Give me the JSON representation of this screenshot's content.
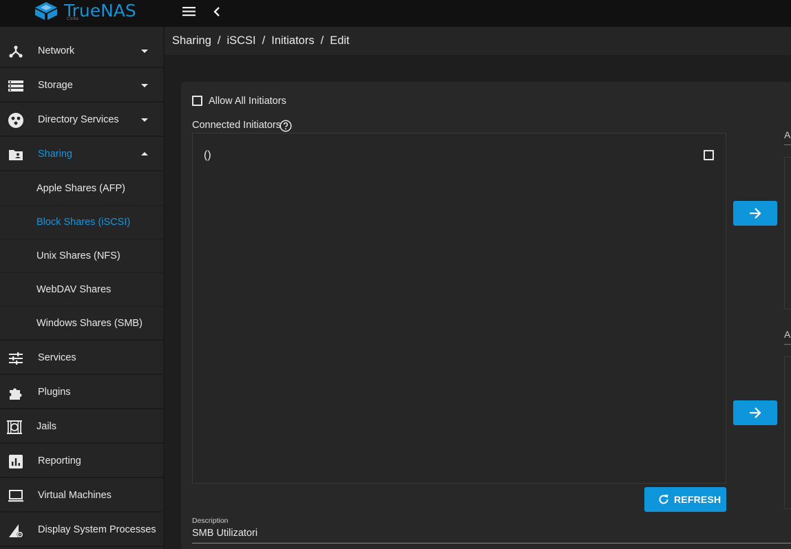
{
  "app": {
    "logo_text": "TrueNAS",
    "logo_subtext": "CORE",
    "accent_color": "#0f95d9"
  },
  "topbar": {
    "menu_icon": "hamburger-menu-icon",
    "back_icon": "chevron-left-icon"
  },
  "sidebar": {
    "items": [
      {
        "label": "Network",
        "icon": "network-icon",
        "expanded": false
      },
      {
        "label": "Storage",
        "icon": "storage-icon",
        "expanded": false
      },
      {
        "label": "Directory Services",
        "icon": "directory-services-icon",
        "expanded": false
      },
      {
        "label": "Sharing",
        "icon": "sharing-folder-icon",
        "expanded": true,
        "active": true
      },
      {
        "label": "Services",
        "icon": "tune-icon"
      },
      {
        "label": "Plugins",
        "icon": "puzzle-icon"
      },
      {
        "label": "Jails",
        "icon": "jail-icon"
      },
      {
        "label": "Reporting",
        "icon": "bar-chart-icon"
      },
      {
        "label": "Virtual Machines",
        "icon": "laptop-icon"
      },
      {
        "label": "Display System Processes",
        "icon": "system-processes-icon"
      }
    ],
    "sharing_children": [
      {
        "label": "Apple Shares (AFP)"
      },
      {
        "label": "Block Shares (iSCSI)",
        "active": true
      },
      {
        "label": "Unix Shares (NFS)"
      },
      {
        "label": "WebDAV Shares"
      },
      {
        "label": "Windows Shares (SMB)"
      }
    ]
  },
  "breadcrumb": {
    "parts": [
      "Sharing",
      "iSCSI",
      "Initiators",
      "Edit"
    ],
    "separator": "/"
  },
  "form": {
    "allow_all": {
      "label": "Allow All Initiators",
      "checked": false
    },
    "connected_initiators": {
      "label": "Connected Initiators",
      "entries": [
        {
          "text": "()",
          "checked": false
        }
      ]
    },
    "refresh_label": "REFRESH",
    "right_column_labels": [
      "A",
      "A"
    ],
    "description": {
      "label": "Description",
      "value": "SMB Utilizatori"
    }
  }
}
